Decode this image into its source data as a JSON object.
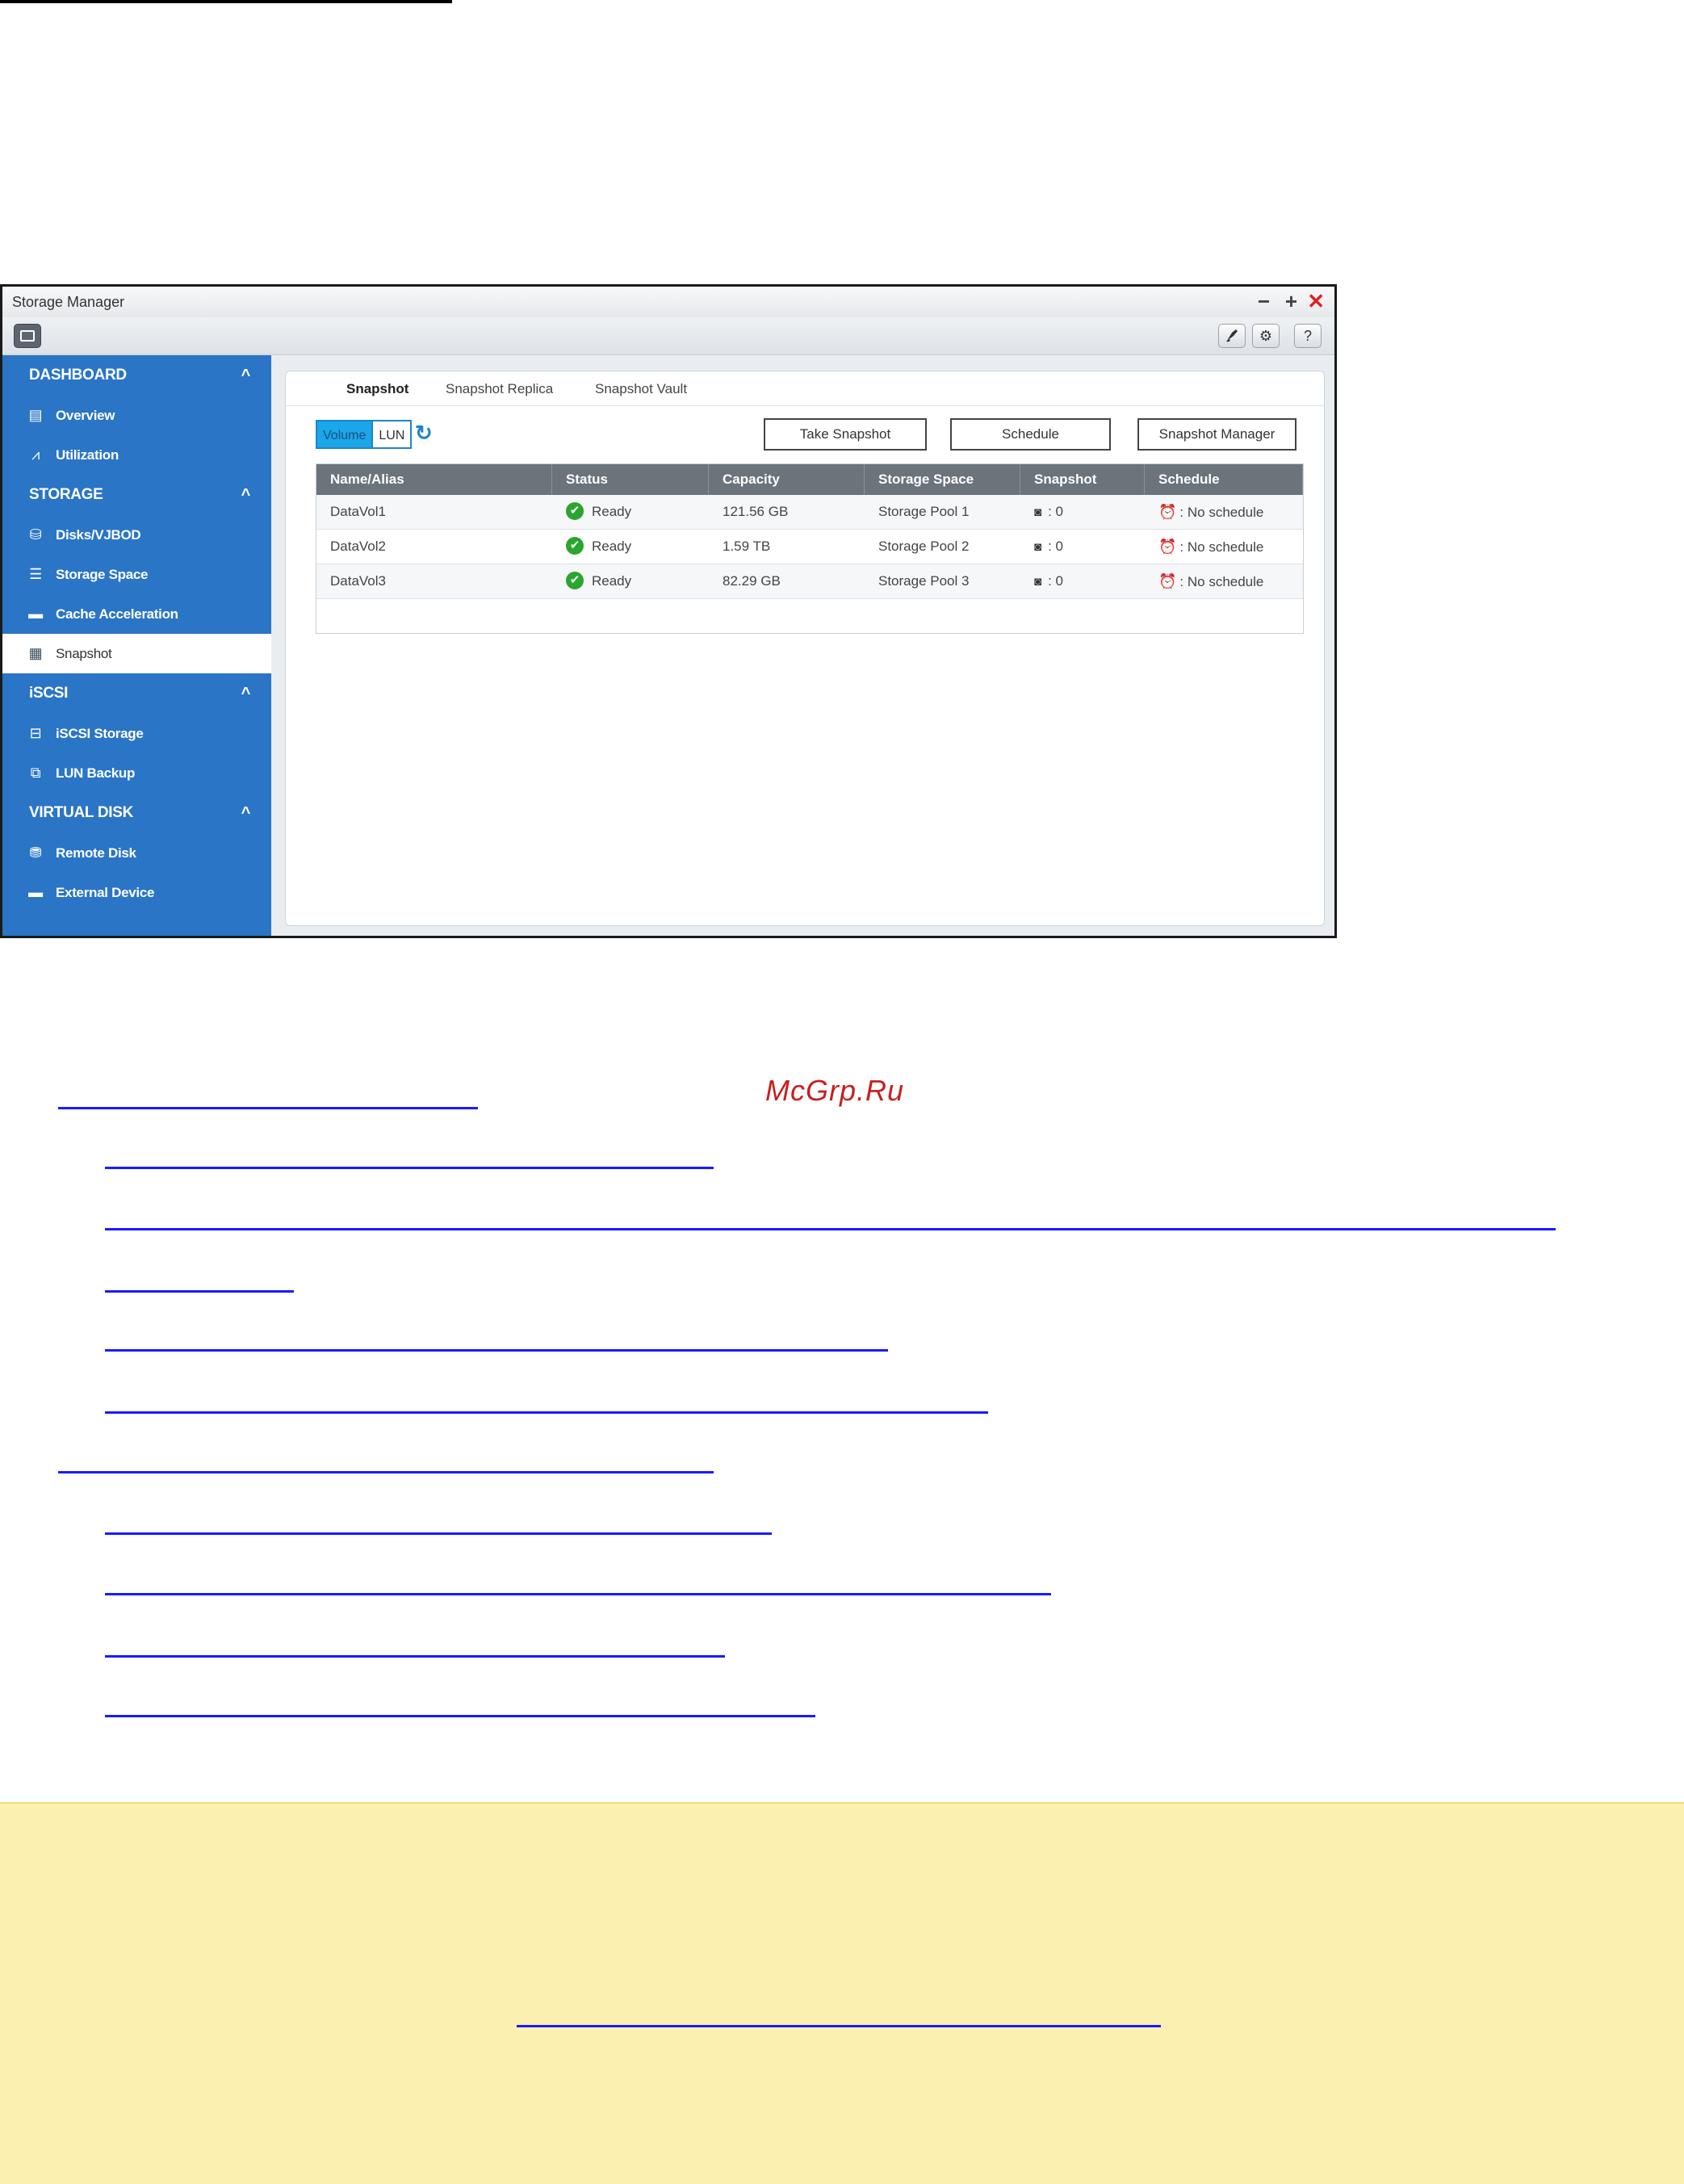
{
  "window": {
    "title": "Storage Manager",
    "controls": {
      "minimize": "−",
      "maximize": "+",
      "close": "✕"
    }
  },
  "toolbar": {
    "settings_icon": "⚙",
    "help_label": "?"
  },
  "sidebar": {
    "sections": [
      {
        "label": "DASHBOARD",
        "items": [
          {
            "label": "Overview"
          },
          {
            "label": "Utilization"
          }
        ]
      },
      {
        "label": "STORAGE",
        "items": [
          {
            "label": "Disks/VJBOD"
          },
          {
            "label": "Storage Space"
          },
          {
            "label": "Cache Acceleration"
          },
          {
            "label": "Snapshot"
          }
        ]
      },
      {
        "label": "iSCSI",
        "items": [
          {
            "label": "iSCSI Storage"
          },
          {
            "label": "LUN Backup"
          }
        ]
      },
      {
        "label": "VIRTUAL DISK",
        "items": [
          {
            "label": "Remote Disk"
          },
          {
            "label": "External Device"
          }
        ]
      }
    ],
    "active_item": "Snapshot"
  },
  "tabs": [
    {
      "label": "Snapshot"
    },
    {
      "label": "Snapshot Replica"
    },
    {
      "label": "Snapshot Vault"
    }
  ],
  "filter": {
    "volume_label": "Volume",
    "lun_label": "LUN",
    "selected": "Volume"
  },
  "actions": {
    "take_snapshot": "Take Snapshot",
    "schedule": "Schedule",
    "snapshot_manager": "Snapshot Manager"
  },
  "table": {
    "columns": [
      "Name/Alias",
      "Status",
      "Capacity",
      "Storage Space",
      "Snapshot",
      "Schedule"
    ],
    "rows": [
      {
        "name": "DataVol1",
        "status": "Ready",
        "capacity": "121.56 GB",
        "storage_space": "Storage Pool 1",
        "snapshot": ": 0",
        "schedule": ": No schedule"
      },
      {
        "name": "DataVol2",
        "status": "Ready",
        "capacity": "1.59 TB",
        "storage_space": "Storage Pool 2",
        "snapshot": ": 0",
        "schedule": ": No schedule"
      },
      {
        "name": "DataVol3",
        "status": "Ready",
        "capacity": "82.29 GB",
        "storage_space": "Storage Pool 3",
        "snapshot": ": 0",
        "schedule": ": No schedule"
      }
    ]
  },
  "watermark": "McGrp.Ru",
  "colors": {
    "sidebar": "#2a75c6",
    "accent": "#1aa6e8",
    "close": "#e02020",
    "ok": "#2aa52e",
    "link": "#1a1aff",
    "note_bg": "#fcf0b0"
  }
}
